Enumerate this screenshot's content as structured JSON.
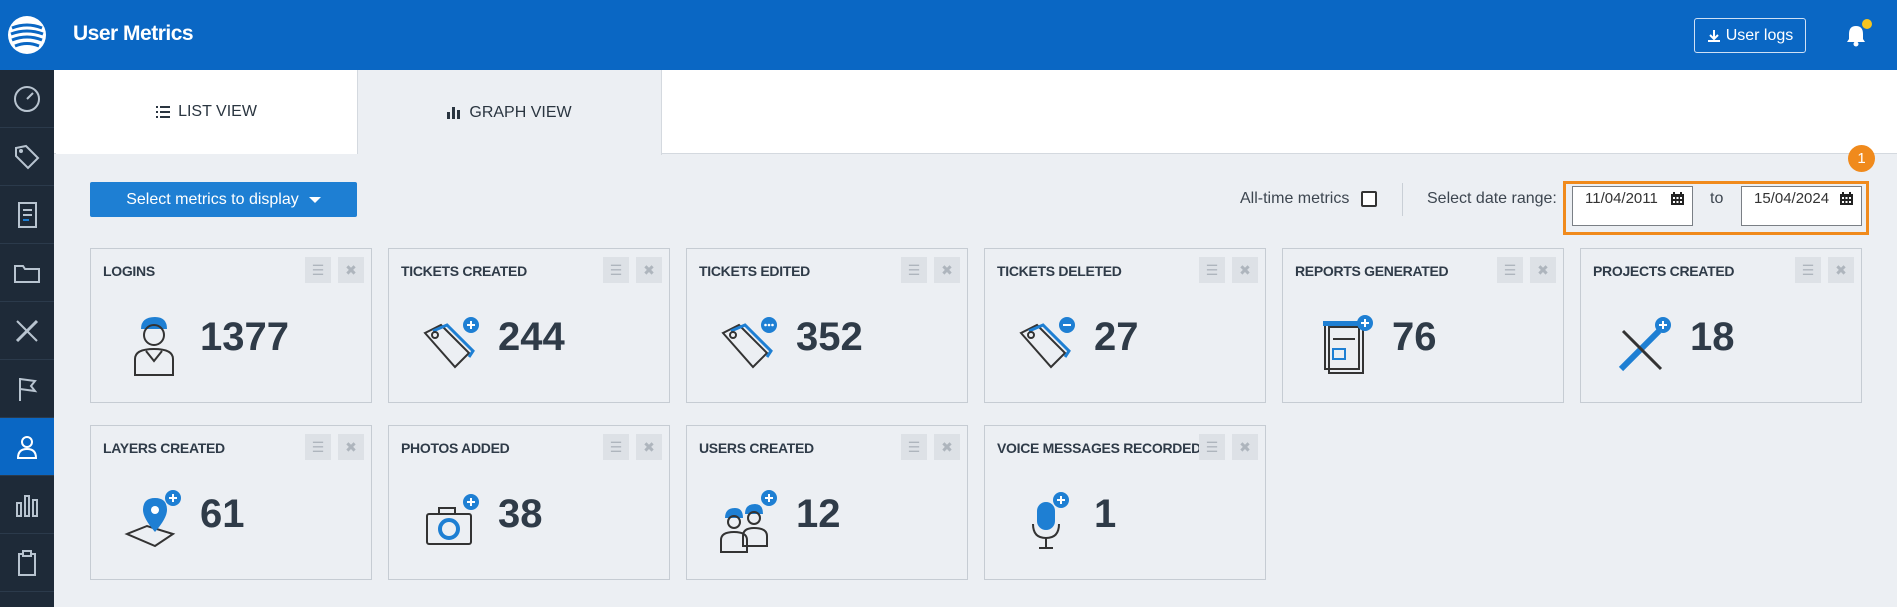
{
  "header": {
    "title": "User Metrics",
    "user_logs_label": "User logs"
  },
  "tabs": [
    {
      "label": "LIST VIEW",
      "icon": "list-icon"
    },
    {
      "label": "GRAPH VIEW",
      "icon": "bar-chart-icon",
      "active": true
    }
  ],
  "toolbar": {
    "select_metrics_label": "Select metrics to display",
    "all_time_label": "All-time metrics",
    "all_time_checked": false,
    "date_range_label": "Select date range:",
    "date_from": "11/04/2011",
    "to_label": "to",
    "date_to": "15/04/2024",
    "annotation_badge": "1"
  },
  "sidebar": {
    "items": [
      "dashboard-icon",
      "tag-icon",
      "document-icon",
      "folder-icon",
      "ruler-pencil-icon",
      "flag-icon",
      "user-icon",
      "bar-chart-icon",
      "clipboard-icon"
    ],
    "active_index": 6
  },
  "metrics": [
    {
      "title": "LOGINS",
      "value": "1377",
      "icon": "worker-icon"
    },
    {
      "title": "TICKETS CREATED",
      "value": "244",
      "icon": "ticket-add-icon"
    },
    {
      "title": "TICKETS EDITED",
      "value": "352",
      "icon": "ticket-edit-icon"
    },
    {
      "title": "TICKETS DELETED",
      "value": "27",
      "icon": "ticket-delete-icon"
    },
    {
      "title": "REPORTS GENERATED",
      "value": "76",
      "icon": "report-icon"
    },
    {
      "title": "PROJECTS CREATED",
      "value": "18",
      "icon": "project-icon"
    },
    {
      "title": "LAYERS CREATED",
      "value": "61",
      "icon": "layer-icon"
    },
    {
      "title": "PHOTOS ADDED",
      "value": "38",
      "icon": "camera-icon"
    },
    {
      "title": "USERS CREATED",
      "value": "12",
      "icon": "users-icon"
    },
    {
      "title": "VOICE MESSAGES RECORDED",
      "value": "1",
      "icon": "microphone-icon"
    }
  ],
  "colors": {
    "primary": "#0a67c4",
    "button": "#1e7fd3",
    "accent": "#f08a1c",
    "sidebar": "#1e2a38",
    "notification": "#f7c51e"
  }
}
